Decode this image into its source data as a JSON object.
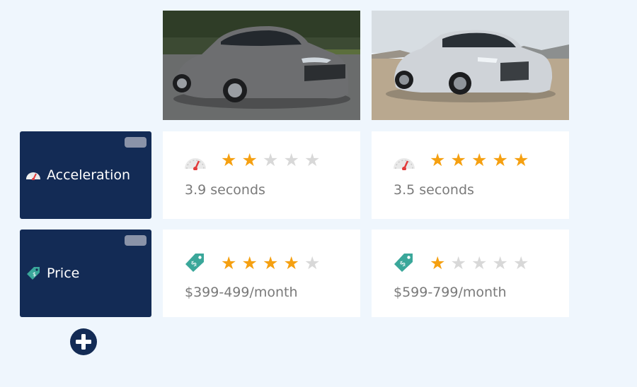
{
  "cars": [
    {
      "image_icon": "sedan-photo",
      "color": "#6d6e70"
    },
    {
      "image_icon": "sportback-photo",
      "color": "#cfd3d8"
    }
  ],
  "rows": [
    {
      "label": "Acceleration",
      "icon": "speedometer-icon",
      "cells": [
        {
          "value": "3.9 seconds",
          "rating": 2,
          "max": 5
        },
        {
          "value": "3.5 seconds",
          "rating": 5,
          "max": 5
        }
      ]
    },
    {
      "label": "Price",
      "icon": "price-tag-icon",
      "cells": [
        {
          "value": "$399-499/month",
          "rating": 4,
          "max": 5
        },
        {
          "value": "$599-799/month",
          "rating": 1,
          "max": 5
        }
      ]
    }
  ],
  "add_button": {
    "icon": "plus-icon"
  },
  "colors": {
    "accent": "#132b55",
    "star_on": "#f5a011",
    "star_off": "#d8d8d8",
    "tag": "#3aa79a",
    "background": "#eff6fd"
  }
}
